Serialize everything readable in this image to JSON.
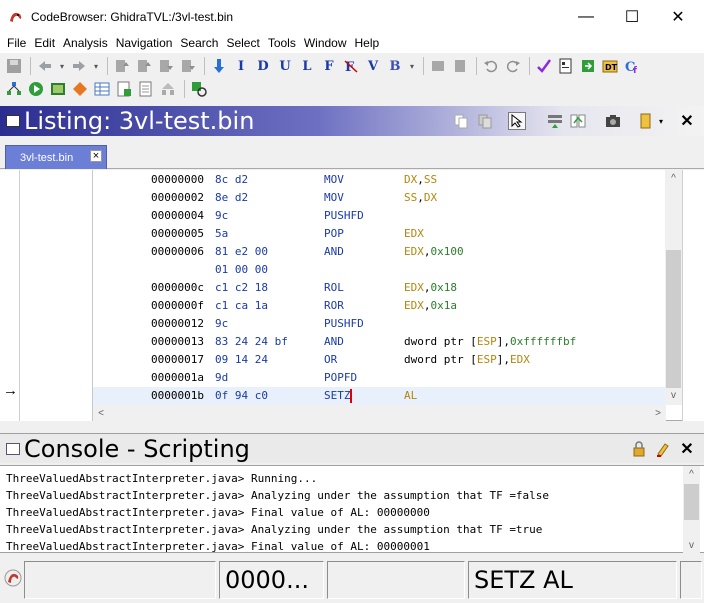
{
  "window": {
    "title": "CodeBrowser: GhidraTVL:/3vl-test.bin",
    "minimize_glyph": "—",
    "maximize_glyph": "☐",
    "close_glyph": "✕"
  },
  "menu": [
    "File",
    "Edit",
    "Analysis",
    "Navigation",
    "Search",
    "Select",
    "Tools",
    "Window",
    "Help"
  ],
  "toolbar1": {
    "icons": [
      "save-icon",
      "back-icon",
      "forward-icon",
      "next-instruction-icon",
      "next-data-icon",
      "next-undefined-icon",
      "next-label-icon",
      "next-function-icon",
      "next-bookmark-icon",
      "undo-icon",
      "redo-icon",
      "checkmark-icon",
      "data-type-icon",
      "function-icon"
    ],
    "letter_buttons": [
      "I",
      "D",
      "U",
      "L",
      "F",
      "V",
      "B"
    ]
  },
  "toolbar2": {
    "icons": [
      "function-graph-icon",
      "run-script-icon",
      "memory-map-icon",
      "diamond-icon",
      "table-icon",
      "bytes-icon",
      "pages-icon",
      "network-icon",
      "refresh-icon"
    ]
  },
  "listing": {
    "title": "Listing:  3vl-test.bin",
    "tab_label": "3vl-test.bin",
    "tab_close": "×",
    "gutter_arrow": "→",
    "rows": [
      {
        "addr": "00000000",
        "bytes": "8c d2",
        "mnemonic": "MOV",
        "ops": [
          {
            "t": "DX",
            "k": "reg"
          },
          {
            "t": ",",
            "k": "plain"
          },
          {
            "t": "SS",
            "k": "reg"
          }
        ]
      },
      {
        "addr": "00000002",
        "bytes": "8e d2",
        "mnemonic": "MOV",
        "ops": [
          {
            "t": "SS",
            "k": "reg"
          },
          {
            "t": ",",
            "k": "plain"
          },
          {
            "t": "DX",
            "k": "reg"
          }
        ]
      },
      {
        "addr": "00000004",
        "bytes": "9c",
        "mnemonic": "PUSHFD",
        "ops": []
      },
      {
        "addr": "00000005",
        "bytes": "5a",
        "mnemonic": "POP",
        "ops": [
          {
            "t": "EDX",
            "k": "reg"
          }
        ]
      },
      {
        "addr": "00000006",
        "bytes": "81 e2 00",
        "mnemonic": "AND",
        "ops": [
          {
            "t": "EDX",
            "k": "reg"
          },
          {
            "t": ",",
            "k": "plain"
          },
          {
            "t": "0x100",
            "k": "num"
          }
        ]
      },
      {
        "addr": "",
        "bytes": "01 00 00",
        "mnemonic": "",
        "ops": []
      },
      {
        "addr": "0000000c",
        "bytes": "c1 c2 18",
        "mnemonic": "ROL",
        "ops": [
          {
            "t": "EDX",
            "k": "reg"
          },
          {
            "t": ",",
            "k": "plain"
          },
          {
            "t": "0x18",
            "k": "num"
          }
        ]
      },
      {
        "addr": "0000000f",
        "bytes": "c1 ca 1a",
        "mnemonic": "ROR",
        "ops": [
          {
            "t": "EDX",
            "k": "reg"
          },
          {
            "t": ",",
            "k": "plain"
          },
          {
            "t": "0x1a",
            "k": "num"
          }
        ]
      },
      {
        "addr": "00000012",
        "bytes": "9c",
        "mnemonic": "PUSHFD",
        "ops": []
      },
      {
        "addr": "00000013",
        "bytes": "83 24 24 bf",
        "mnemonic": "AND",
        "ops": [
          {
            "t": "dword ptr [",
            "k": "plain"
          },
          {
            "t": "ESP",
            "k": "reg"
          },
          {
            "t": "],",
            "k": "plain"
          },
          {
            "t": "0xffffffbf",
            "k": "num"
          }
        ]
      },
      {
        "addr": "00000017",
        "bytes": "09 14 24",
        "mnemonic": "OR",
        "ops": [
          {
            "t": "dword ptr [",
            "k": "plain"
          },
          {
            "t": "ESP",
            "k": "reg"
          },
          {
            "t": "],",
            "k": "plain"
          },
          {
            "t": "EDX",
            "k": "reg"
          }
        ]
      },
      {
        "addr": "0000001a",
        "bytes": "9d",
        "mnemonic": "POPFD",
        "ops": []
      },
      {
        "addr": "0000001b",
        "bytes": "0f 94 c0",
        "mnemonic": "SETZ",
        "ops": [
          {
            "t": "AL",
            "k": "reg"
          }
        ],
        "selected": true
      }
    ]
  },
  "console": {
    "title": "Console - Scripting",
    "lines": [
      "ThreeValuedAbstractInterpreter.java> Running...",
      "ThreeValuedAbstractInterpreter.java> Analyzing under the assumption that TF =false",
      "ThreeValuedAbstractInterpreter.java> Final value of AL: 00000000",
      "ThreeValuedAbstractInterpreter.java> Analyzing under the assumption that TF =true",
      "ThreeValuedAbstractInterpreter.java> Final value of AL: 00000001"
    ]
  },
  "status": {
    "address": "0000...",
    "instruction": "SETZ AL"
  },
  "colors": {
    "mnemonic": "#1a3aa8",
    "register": "#b3860b",
    "immediate": "#2a7d2a",
    "listing_header_start": "#2b2e8f"
  }
}
